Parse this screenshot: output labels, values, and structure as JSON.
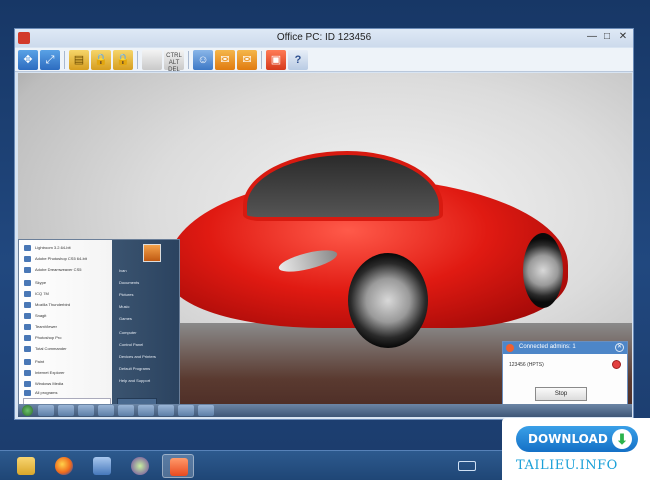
{
  "window": {
    "title": "Office PC: ID 123456",
    "controls": {
      "minimize": "—",
      "maximize": "□",
      "close": "✕"
    }
  },
  "toolbar": {
    "keys_label": "CTRL ALT DEL",
    "help_label": "?"
  },
  "connected_panel": {
    "title": "Connected admins: 1",
    "connection": "123456 (HPTS)",
    "stop_label": "Stop",
    "close_glyph": "✕"
  },
  "remote_start_menu": {
    "left_items": [
      "Lightroom 3.2.64-bit",
      "Adobe Photoshop CS5 64-bit",
      "Adobe Dreamweaver CS5",
      "Skype",
      "ICQ 7M",
      "Mozilla Thunderbird",
      "Snagit",
      "TeamViewer",
      "Photoshop Pro",
      "Total Commander",
      "Paint",
      "Internet Explorer",
      "Windows Media"
    ],
    "right_items": [
      "Ivan",
      "Documents",
      "Pictures",
      "Music",
      "Games",
      "Computer",
      "Control Panel",
      "Devices and Printers",
      "Default Programs",
      "Help and Support"
    ],
    "all_programs": "All programs"
  },
  "watermark": {
    "button": "DOWNLOAD",
    "site": "TAILIEU.INFO"
  },
  "colors": {
    "accent": "#4d86c8",
    "car": "#e01a12",
    "taskbar": "#1f4676"
  }
}
